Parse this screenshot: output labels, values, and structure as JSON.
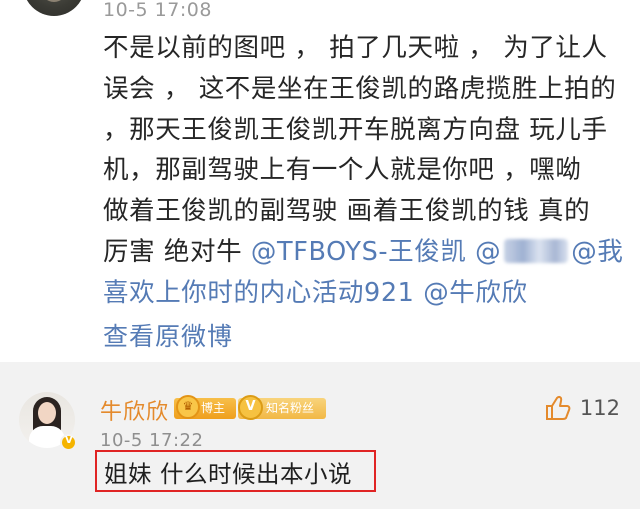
{
  "top_comment": {
    "timestamp": "10-5 17:08",
    "lines": [
      "不是以前的图吧 ， 拍了几天啦 ， 为了让人",
      "误会 ， 这不是坐在王俊凯的路虎揽胜上拍的",
      "，那天王俊凯王俊凯开车脱离方向盘 玩儿手",
      "机，那副驾驶上有一个人就是你吧 ，嘿呦",
      "做着王俊凯的副驾驶 画着王俊凯的钱 真的"
    ],
    "line6_prefix": "厉害 绝对牛 ",
    "mention_tfboys": "@TFBOYS-王俊凯",
    "mention_blurred_prefix": "@",
    "mention_xinli": "@我",
    "line7_mention": "喜欢上你时的内心活动921",
    "line7_space": " ",
    "mention_niu": "@牛欣欣",
    "view_original": "查看原微博"
  },
  "reply": {
    "username": "牛欣欣",
    "badge_author": "博主",
    "badge_fan": "知名粉丝",
    "timestamp": "10-5 17:22",
    "text": "姐妹 什么时候出本小说",
    "like_count": "112"
  },
  "colors": {
    "link": "#557bb5",
    "username": "#e48a2c",
    "highlight_box": "#e02424",
    "like_icon": "#e48a2c"
  },
  "icons": {
    "like": "thumbs-up-icon",
    "verified": "verified-badge-icon",
    "crown": "crown-icon"
  }
}
